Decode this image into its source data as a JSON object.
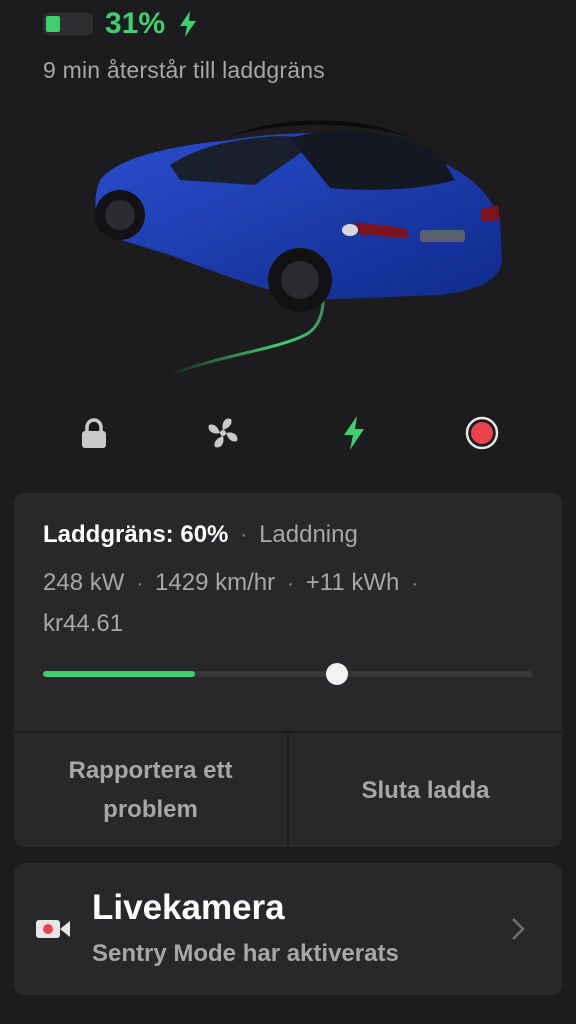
{
  "status": {
    "battery_percent": 31,
    "battery_text": "31%",
    "remaining_text": "9 min återstår till laddgräns"
  },
  "controls": {
    "icons": [
      "lock-icon",
      "fan-icon",
      "charge-bolt-icon",
      "record-icon"
    ]
  },
  "charging": {
    "limit_label": "Laddgräns: 60%",
    "state_label": "Laddning",
    "stats": [
      "248 kW",
      "1429 km/hr",
      "+11 kWh",
      "kr44.61"
    ],
    "current_level": 0.31,
    "limit_level": 0.6,
    "report_label": "Rapportera ett problem",
    "stop_label": "Sluta ladda"
  },
  "camera": {
    "title": "Livekamera",
    "subtitle": "Sentry Mode har aktiverats"
  },
  "colors": {
    "accent_green": "#3ecf6e",
    "record_red": "#e8434f",
    "background": "#1c1c1e",
    "card": "#28282a"
  }
}
